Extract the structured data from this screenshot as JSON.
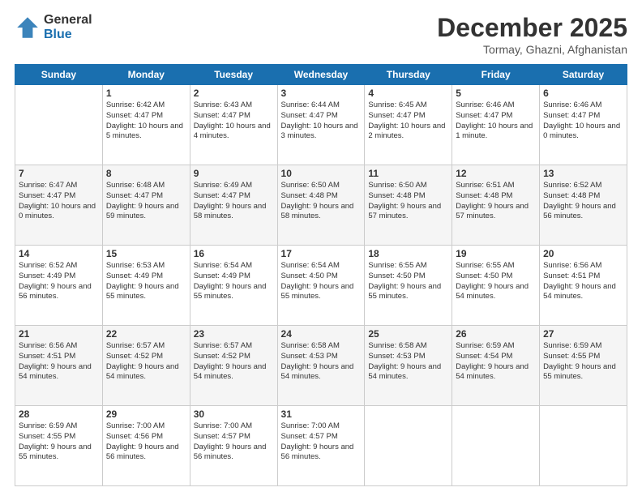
{
  "logo": {
    "general": "General",
    "blue": "Blue"
  },
  "title": "December 2025",
  "location": "Tormay, Ghazni, Afghanistan",
  "days_of_week": [
    "Sunday",
    "Monday",
    "Tuesday",
    "Wednesday",
    "Thursday",
    "Friday",
    "Saturday"
  ],
  "weeks": [
    [
      {
        "day": "",
        "sunrise": "",
        "sunset": "",
        "daylight": ""
      },
      {
        "day": "1",
        "sunrise": "Sunrise: 6:42 AM",
        "sunset": "Sunset: 4:47 PM",
        "daylight": "Daylight: 10 hours and 5 minutes."
      },
      {
        "day": "2",
        "sunrise": "Sunrise: 6:43 AM",
        "sunset": "Sunset: 4:47 PM",
        "daylight": "Daylight: 10 hours and 4 minutes."
      },
      {
        "day": "3",
        "sunrise": "Sunrise: 6:44 AM",
        "sunset": "Sunset: 4:47 PM",
        "daylight": "Daylight: 10 hours and 3 minutes."
      },
      {
        "day": "4",
        "sunrise": "Sunrise: 6:45 AM",
        "sunset": "Sunset: 4:47 PM",
        "daylight": "Daylight: 10 hours and 2 minutes."
      },
      {
        "day": "5",
        "sunrise": "Sunrise: 6:46 AM",
        "sunset": "Sunset: 4:47 PM",
        "daylight": "Daylight: 10 hours and 1 minute."
      },
      {
        "day": "6",
        "sunrise": "Sunrise: 6:46 AM",
        "sunset": "Sunset: 4:47 PM",
        "daylight": "Daylight: 10 hours and 0 minutes."
      }
    ],
    [
      {
        "day": "7",
        "sunrise": "Sunrise: 6:47 AM",
        "sunset": "Sunset: 4:47 PM",
        "daylight": "Daylight: 10 hours and 0 minutes."
      },
      {
        "day": "8",
        "sunrise": "Sunrise: 6:48 AM",
        "sunset": "Sunset: 4:47 PM",
        "daylight": "Daylight: 9 hours and 59 minutes."
      },
      {
        "day": "9",
        "sunrise": "Sunrise: 6:49 AM",
        "sunset": "Sunset: 4:47 PM",
        "daylight": "Daylight: 9 hours and 58 minutes."
      },
      {
        "day": "10",
        "sunrise": "Sunrise: 6:50 AM",
        "sunset": "Sunset: 4:48 PM",
        "daylight": "Daylight: 9 hours and 58 minutes."
      },
      {
        "day": "11",
        "sunrise": "Sunrise: 6:50 AM",
        "sunset": "Sunset: 4:48 PM",
        "daylight": "Daylight: 9 hours and 57 minutes."
      },
      {
        "day": "12",
        "sunrise": "Sunrise: 6:51 AM",
        "sunset": "Sunset: 4:48 PM",
        "daylight": "Daylight: 9 hours and 57 minutes."
      },
      {
        "day": "13",
        "sunrise": "Sunrise: 6:52 AM",
        "sunset": "Sunset: 4:48 PM",
        "daylight": "Daylight: 9 hours and 56 minutes."
      }
    ],
    [
      {
        "day": "14",
        "sunrise": "Sunrise: 6:52 AM",
        "sunset": "Sunset: 4:49 PM",
        "daylight": "Daylight: 9 hours and 56 minutes."
      },
      {
        "day": "15",
        "sunrise": "Sunrise: 6:53 AM",
        "sunset": "Sunset: 4:49 PM",
        "daylight": "Daylight: 9 hours and 55 minutes."
      },
      {
        "day": "16",
        "sunrise": "Sunrise: 6:54 AM",
        "sunset": "Sunset: 4:49 PM",
        "daylight": "Daylight: 9 hours and 55 minutes."
      },
      {
        "day": "17",
        "sunrise": "Sunrise: 6:54 AM",
        "sunset": "Sunset: 4:50 PM",
        "daylight": "Daylight: 9 hours and 55 minutes."
      },
      {
        "day": "18",
        "sunrise": "Sunrise: 6:55 AM",
        "sunset": "Sunset: 4:50 PM",
        "daylight": "Daylight: 9 hours and 55 minutes."
      },
      {
        "day": "19",
        "sunrise": "Sunrise: 6:55 AM",
        "sunset": "Sunset: 4:50 PM",
        "daylight": "Daylight: 9 hours and 54 minutes."
      },
      {
        "day": "20",
        "sunrise": "Sunrise: 6:56 AM",
        "sunset": "Sunset: 4:51 PM",
        "daylight": "Daylight: 9 hours and 54 minutes."
      }
    ],
    [
      {
        "day": "21",
        "sunrise": "Sunrise: 6:56 AM",
        "sunset": "Sunset: 4:51 PM",
        "daylight": "Daylight: 9 hours and 54 minutes."
      },
      {
        "day": "22",
        "sunrise": "Sunrise: 6:57 AM",
        "sunset": "Sunset: 4:52 PM",
        "daylight": "Daylight: 9 hours and 54 minutes."
      },
      {
        "day": "23",
        "sunrise": "Sunrise: 6:57 AM",
        "sunset": "Sunset: 4:52 PM",
        "daylight": "Daylight: 9 hours and 54 minutes."
      },
      {
        "day": "24",
        "sunrise": "Sunrise: 6:58 AM",
        "sunset": "Sunset: 4:53 PM",
        "daylight": "Daylight: 9 hours and 54 minutes."
      },
      {
        "day": "25",
        "sunrise": "Sunrise: 6:58 AM",
        "sunset": "Sunset: 4:53 PM",
        "daylight": "Daylight: 9 hours and 54 minutes."
      },
      {
        "day": "26",
        "sunrise": "Sunrise: 6:59 AM",
        "sunset": "Sunset: 4:54 PM",
        "daylight": "Daylight: 9 hours and 54 minutes."
      },
      {
        "day": "27",
        "sunrise": "Sunrise: 6:59 AM",
        "sunset": "Sunset: 4:55 PM",
        "daylight": "Daylight: 9 hours and 55 minutes."
      }
    ],
    [
      {
        "day": "28",
        "sunrise": "Sunrise: 6:59 AM",
        "sunset": "Sunset: 4:55 PM",
        "daylight": "Daylight: 9 hours and 55 minutes."
      },
      {
        "day": "29",
        "sunrise": "Sunrise: 7:00 AM",
        "sunset": "Sunset: 4:56 PM",
        "daylight": "Daylight: 9 hours and 56 minutes."
      },
      {
        "day": "30",
        "sunrise": "Sunrise: 7:00 AM",
        "sunset": "Sunset: 4:57 PM",
        "daylight": "Daylight: 9 hours and 56 minutes."
      },
      {
        "day": "31",
        "sunrise": "Sunrise: 7:00 AM",
        "sunset": "Sunset: 4:57 PM",
        "daylight": "Daylight: 9 hours and 56 minutes."
      },
      {
        "day": "",
        "sunrise": "",
        "sunset": "",
        "daylight": ""
      },
      {
        "day": "",
        "sunrise": "",
        "sunset": "",
        "daylight": ""
      },
      {
        "day": "",
        "sunrise": "",
        "sunset": "",
        "daylight": ""
      }
    ]
  ]
}
